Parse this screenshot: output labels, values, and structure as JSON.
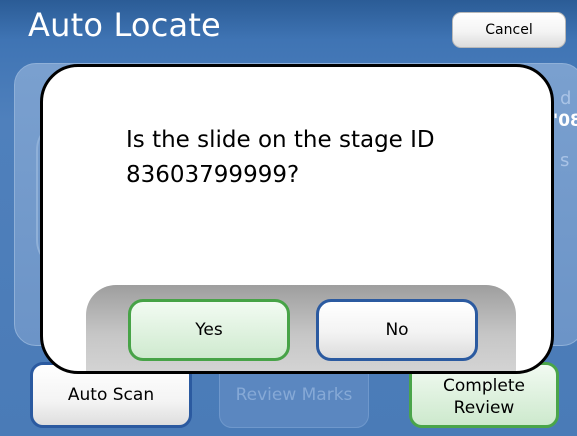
{
  "header": {
    "title": "Auto Locate",
    "cancel_label": "Cancel"
  },
  "background_peek": {
    "line1": "d",
    "line2": "'08",
    "line3": "s"
  },
  "bottom_bar": {
    "auto_scan_label": "Auto Scan",
    "review_marks_label": "Review Marks",
    "complete_review_line1": "Complete",
    "complete_review_line2": "Review"
  },
  "dialog": {
    "message_line1": "Is the slide on the stage ID",
    "message_line2": "83603799999?",
    "yes_label": "Yes",
    "no_label": "No"
  },
  "colors": {
    "background_blue": "#4a7bb7",
    "primary_border_blue": "#2b5aa0",
    "confirm_green": "#4aa54a"
  }
}
